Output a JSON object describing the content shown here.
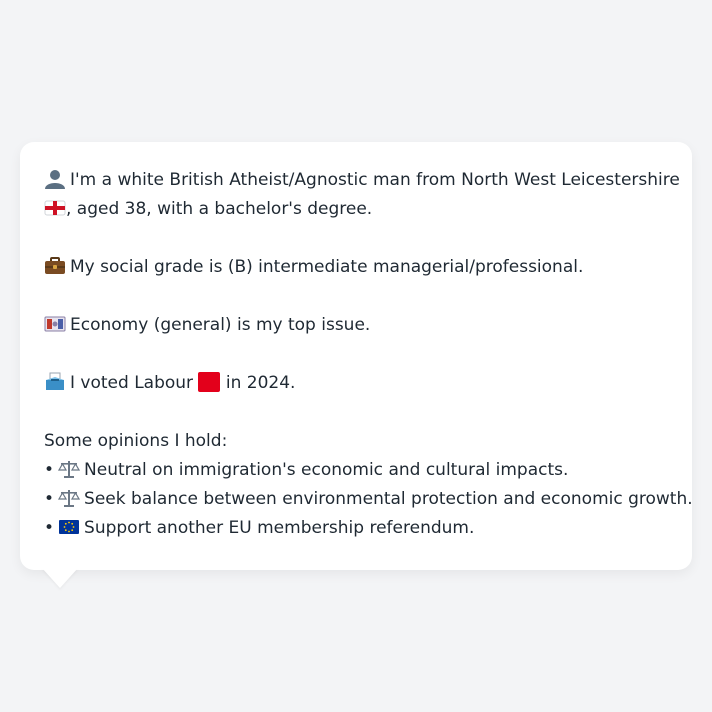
{
  "message": {
    "identity": {
      "icon": "person-silhouette-icon",
      "text_part1": "I'm a white British Atheist/Agnostic man from North West Leicestershire",
      "flag_icon": "england-flag-icon",
      "text_part2": ", aged 38, with a bachelor's degree."
    },
    "social_grade": {
      "icon": "briefcase-icon",
      "text": "My social grade is (B) intermediate managerial/professional."
    },
    "top_issue": {
      "icon": "banknote-icon",
      "text": "Economy (general) is my top issue."
    },
    "vote": {
      "icon": "ballot-box-icon",
      "text_before": "I voted Labour",
      "party_icon": "red-square-icon",
      "text_after": "in 2024."
    },
    "opinions": {
      "heading": "Some opinions I hold:",
      "bullet": "•",
      "items": [
        {
          "icon": "balance-scale-icon",
          "text": "Neutral on immigration's economic and cultural impacts."
        },
        {
          "icon": "balance-scale-icon",
          "text": "Seek balance between environmental protection and economic growth."
        },
        {
          "icon": "eu-flag-icon",
          "text": "Support another EU membership referendum."
        }
      ]
    }
  },
  "colors": {
    "page_background": "#f3f4f6",
    "bubble_background": "#ffffff",
    "text": "#1f2933",
    "labour_red": "#e3001b"
  }
}
